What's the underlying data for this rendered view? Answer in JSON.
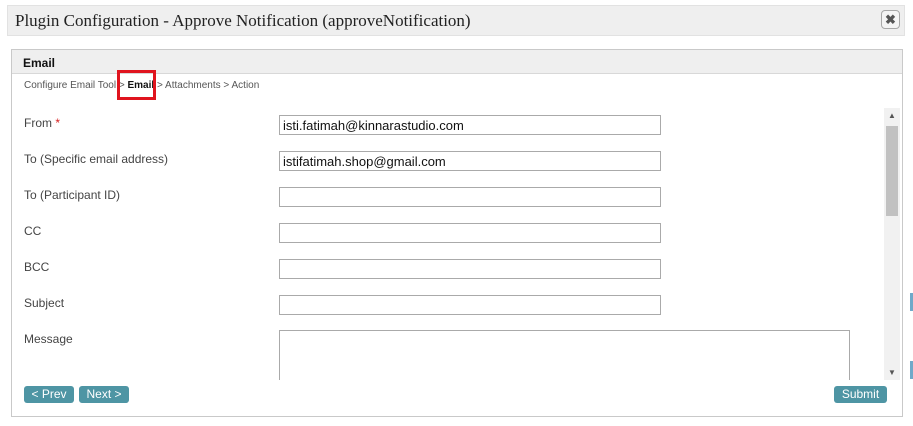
{
  "window": {
    "title": "Plugin Configuration - Approve Notification (approveNotification)",
    "close_icon": "close-icon",
    "close_glyph": "✖"
  },
  "panel": {
    "title": "Email",
    "breadcrumb": {
      "step1": "Configure Email Tool",
      "sep1": " > ",
      "current": "Email",
      "sep2": " > ",
      "step3": "Attachments",
      "sep3": " > ",
      "step4": "Action"
    }
  },
  "form": {
    "from": {
      "label": "From",
      "required": "*",
      "value": "isti.fatimah@kinnarastudio.com"
    },
    "to_email": {
      "label": "To (Specific email address)",
      "value": "istifatimah.shop@gmail.com"
    },
    "to_participant": {
      "label": "To (Participant ID)",
      "value": ""
    },
    "cc": {
      "label": "CC",
      "value": ""
    },
    "bcc": {
      "label": "BCC",
      "value": ""
    },
    "subject": {
      "label": "Subject",
      "value": ""
    },
    "message": {
      "label": "Message",
      "value": ""
    }
  },
  "buttons": {
    "prev": "< Prev",
    "next": "Next >",
    "submit": "Submit"
  },
  "colors": {
    "button": "#4e95a4",
    "highlight": "#e0141e",
    "required": "#d62020"
  }
}
